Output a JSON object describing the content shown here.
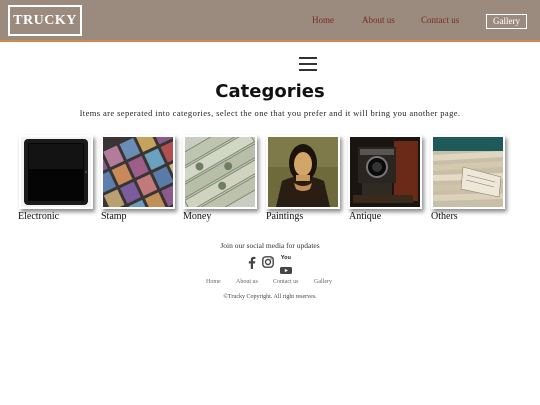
{
  "header": {
    "logo": "TRUCKY",
    "nav": {
      "home": "Home",
      "about": "About us",
      "contact": "Contact us",
      "gallery": "Gallery"
    }
  },
  "main": {
    "title": "Categories",
    "subtitle": "Items are seperated into categories, select the one that you prefer and it will bring you another page.",
    "categories": [
      {
        "label": "Electronic",
        "image": "tablet"
      },
      {
        "label": "Stamp",
        "image": "stamps"
      },
      {
        "label": "Money",
        "image": "banknotes"
      },
      {
        "label": "Paintings",
        "image": "mona-lisa"
      },
      {
        "label": "Antique",
        "image": "old-camera"
      },
      {
        "label": "Others",
        "image": "paper-stack"
      }
    ]
  },
  "footer": {
    "social_text": "Join our social media for updates",
    "social_icons": [
      "facebook-icon",
      "instagram-icon",
      "youtube-icon"
    ],
    "youtube_label": "You",
    "links": {
      "home": "Home",
      "about": "About us",
      "contact": "Contact us",
      "gallery": "Gallery"
    },
    "copyright": "©Trucky Copyright. All right reserves."
  }
}
